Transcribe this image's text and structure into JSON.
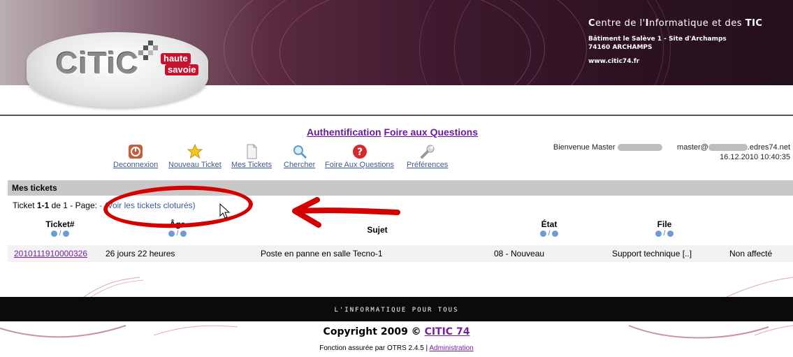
{
  "header": {
    "org_title_prefix": "C",
    "org_title_mid1": "entre de l'",
    "org_title_I": "I",
    "org_title_mid2": "nformatique et des ",
    "org_title_TIC": "TIC",
    "address_line1": "Bâtiment le Salève 1 - Site d'Archamps",
    "address_line2": "74160 ARCHAMPS",
    "website": "www.citic74.fr",
    "logo_text": "CiTiC",
    "logo_haute": "haute",
    "logo_savoie": "savoie"
  },
  "top_links": {
    "auth": "Authentification",
    "faq": "Foire aux Questions"
  },
  "nav": [
    {
      "label": "Deconnexion",
      "icon": "power-icon"
    },
    {
      "label": "Nouveau Ticket",
      "icon": "star-icon"
    },
    {
      "label": "Mes Tickets",
      "icon": "document-icon"
    },
    {
      "label": "Chercher",
      "icon": "magnifier-icon"
    },
    {
      "label": "Foire Aux Questions",
      "icon": "help-icon"
    },
    {
      "label": "Préférences",
      "icon": "wrench-icon"
    }
  ],
  "welcome": {
    "greeting": "Bienvenue Master",
    "email_prefix": "master@",
    "email_suffix": ".edres74.net",
    "datetime": "16.12.2010 10:40:35"
  },
  "section": {
    "title": "Mes tickets"
  },
  "pager": {
    "prefix": "Ticket ",
    "range": "1-1",
    "middle": " de 1 - Page: ",
    "closed_link": "- (Voir les tickets cloturés)"
  },
  "table": {
    "headers": {
      "ticket": "Ticket#",
      "age": "Âge",
      "subject": "Sujet",
      "state": "État",
      "queue": "File"
    },
    "sort_sep": "/",
    "rows": [
      {
        "ticket": "2010111910000326",
        "age": "26 jours 22 heures",
        "subject": "Poste en panne en salle Tecno-1",
        "state": "08 - Nouveau",
        "queue": "Support technique [..]",
        "owner": "Non affecté"
      }
    ]
  },
  "footer": {
    "tagline": "L'INFORMATIQUE POUR TOUS",
    "copyright_prefix": "Copyright 2009 © ",
    "copyright_link": "CITIC 74",
    "powered_prefix": "Fonction assurée par OTRS 2.4.5 | ",
    "admin_link": "Administration"
  },
  "colors": {
    "link_purple": "#7b1fa2",
    "nav_link_blue": "#3a5a99",
    "annotation_red": "#d40000",
    "section_bar_gray": "#c8c8c8"
  }
}
